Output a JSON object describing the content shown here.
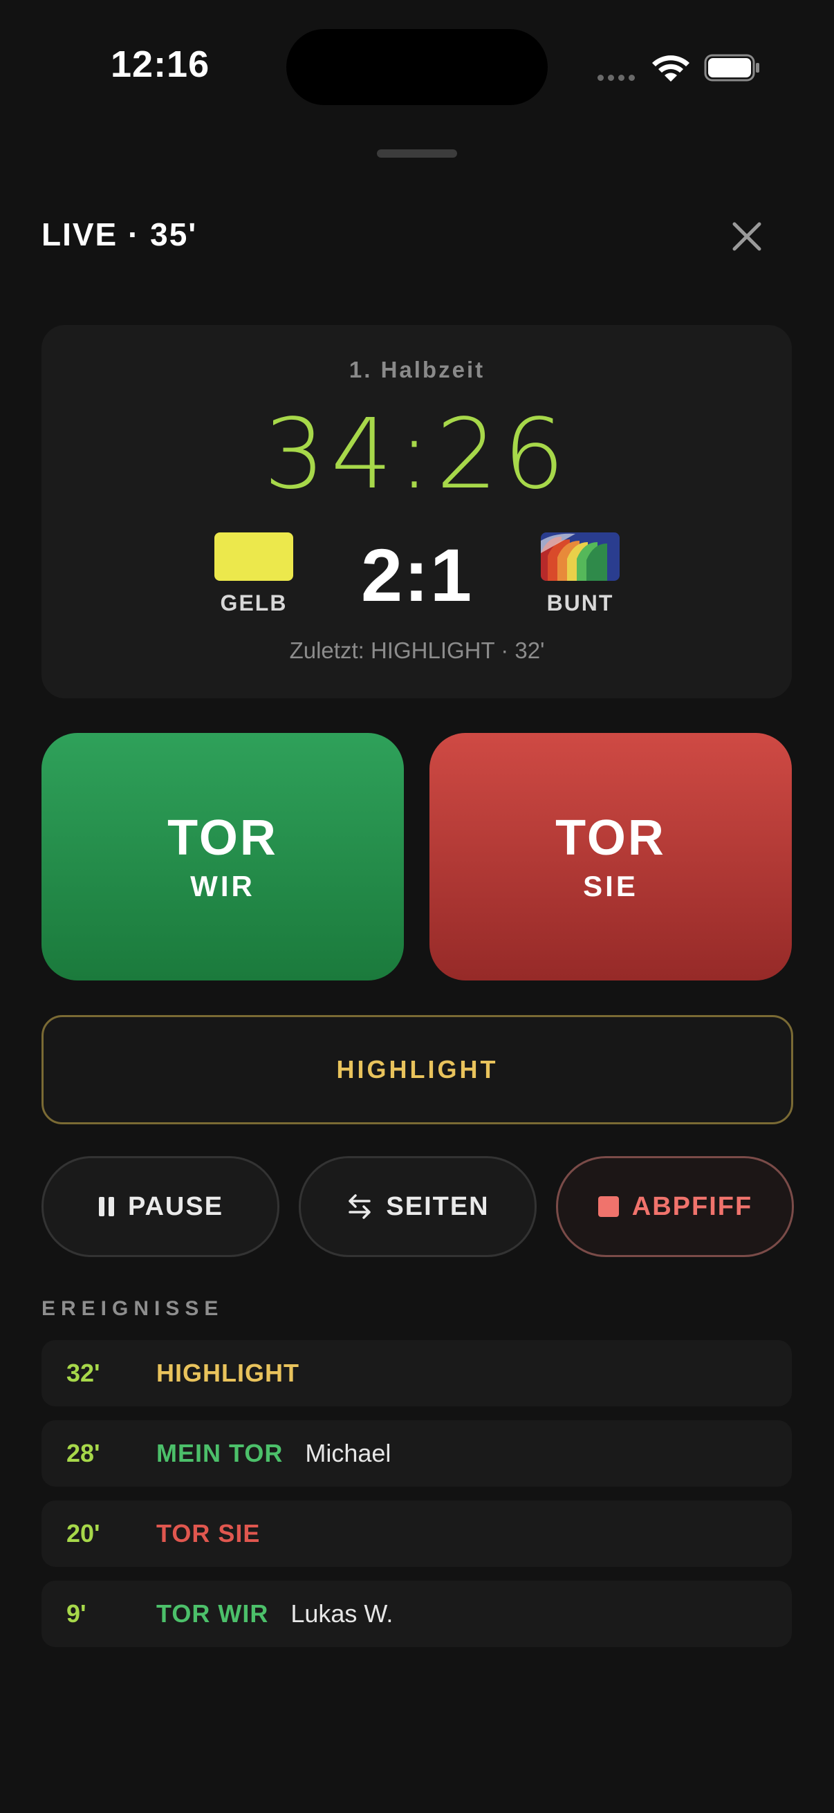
{
  "status_bar": {
    "time": "12:16"
  },
  "header": {
    "title": "LIVE · 35'"
  },
  "match": {
    "half": "1. Halbzeit",
    "clock": "34:26",
    "score": "2:1",
    "home_team": {
      "label": "GELB",
      "color": "#ece84c"
    },
    "away_team": {
      "label": "BUNT"
    },
    "last_event": "Zuletzt: HIGHLIGHT · 32'"
  },
  "actions": {
    "goal_us": {
      "main": "TOR",
      "sub": "WIR",
      "color": "#27914b"
    },
    "goal_them": {
      "main": "TOR",
      "sub": "SIE",
      "color": "#b8393a"
    },
    "highlight": "HIGHLIGHT",
    "pause": "PAUSE",
    "sides": "SEITEN",
    "end": "ABPFIFF"
  },
  "events": {
    "heading": "EREIGNISSE",
    "items": [
      {
        "minute": "32'",
        "type": "HIGHLIGHT",
        "player": "",
        "color": "#e9c35c"
      },
      {
        "minute": "28'",
        "type": "MEIN TOR",
        "player": "Michael",
        "color": "#4cc06a"
      },
      {
        "minute": "20'",
        "type": "TOR SIE",
        "player": "",
        "color": "#e0574f"
      },
      {
        "minute": "9'",
        "type": "TOR WIR",
        "player": "Lukas W.",
        "color": "#4cc06a"
      }
    ]
  },
  "icons": {
    "close": "close-icon",
    "pause": "pause-icon",
    "sides": "swap-arrows-icon",
    "end": "stop-icon"
  }
}
